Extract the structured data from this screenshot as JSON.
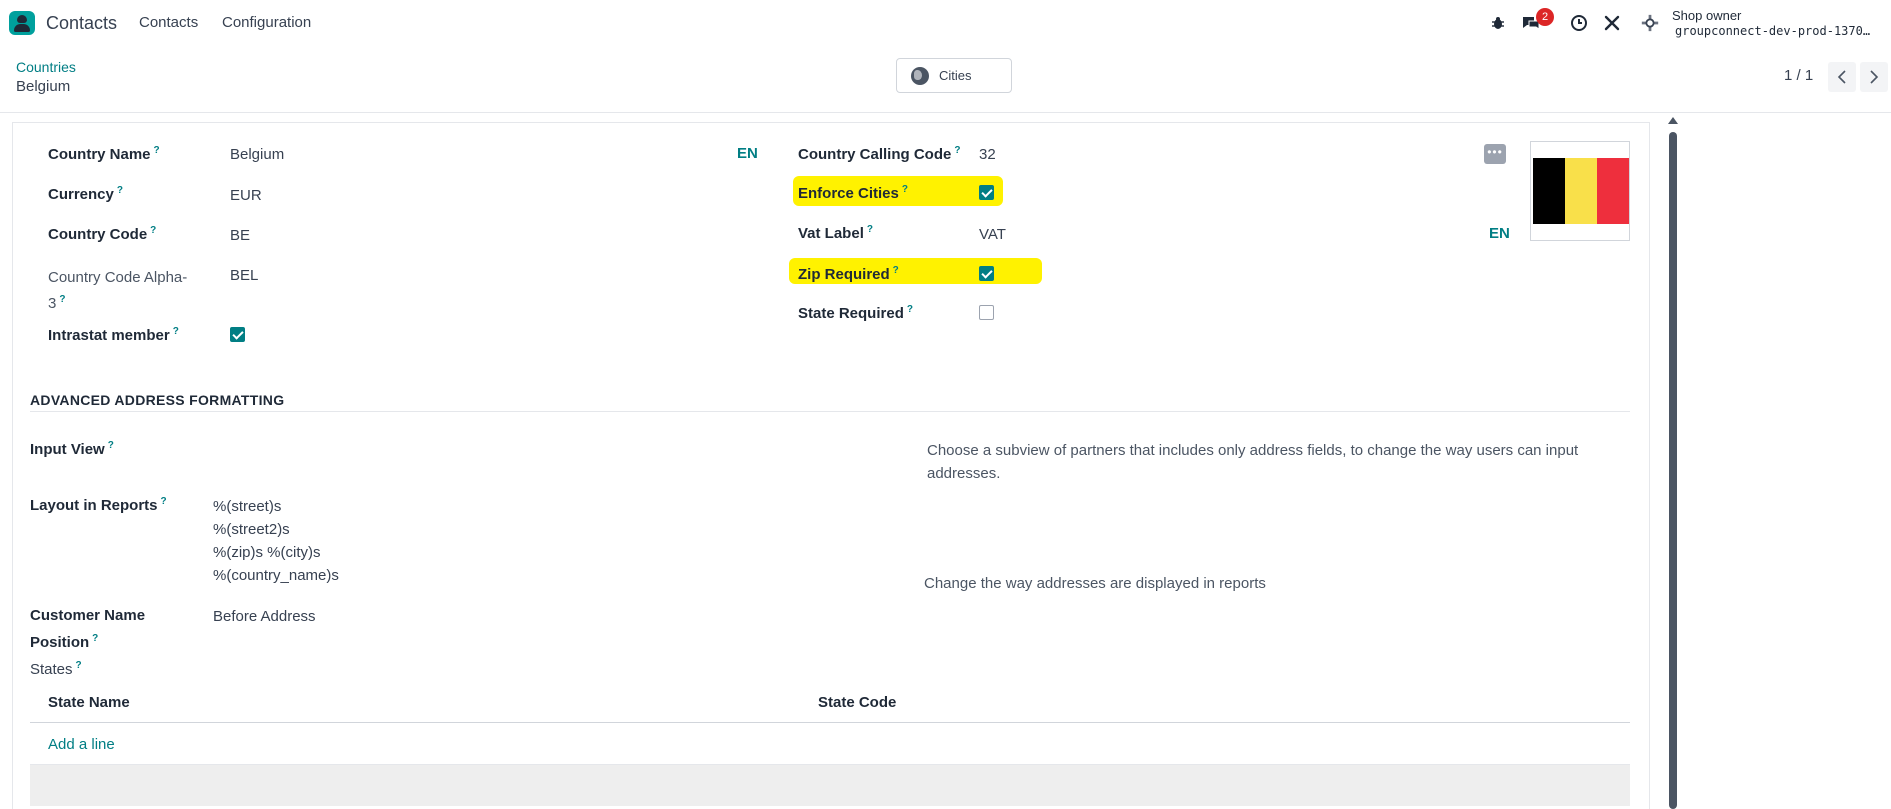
{
  "navbar": {
    "app_name": "Contacts",
    "menu": [
      "Contacts",
      "Configuration"
    ],
    "message_count": "2",
    "user_name": "Shop owner",
    "database": "groupconnect-dev-prod-1370…"
  },
  "control_panel": {
    "breadcrumb_parent": "Countries",
    "breadcrumb_current": "Belgium",
    "smart_button": "Cities",
    "pager": "1 / 1"
  },
  "form": {
    "left": {
      "country_name_label": "Country Name",
      "country_name": "Belgium",
      "lang": "EN",
      "currency_label": "Currency",
      "currency": "EUR",
      "country_code_label": "Country Code",
      "country_code": "BE",
      "alpha3_label_line1": "Country Code Alpha-",
      "alpha3_label_line2": "3",
      "alpha3": "BEL",
      "intrastat_label": "Intrastat member",
      "intrastat": true
    },
    "right": {
      "calling_code_label": "Country Calling Code",
      "calling_code": "32",
      "enforce_cities_label": "Enforce Cities",
      "enforce_cities": true,
      "vat_label_label": "Vat Label",
      "vat_label": "VAT",
      "lang": "EN",
      "zip_required_label": "Zip Required",
      "zip_required": true,
      "state_required_label": "State Required",
      "state_required": false
    },
    "flag_colors": [
      "#000000",
      "#f9e04a",
      "#ee2f3d"
    ],
    "help_mark": "?"
  },
  "advanced": {
    "title": "ADVANCED ADDRESS FORMATTING",
    "input_view_label": "Input View",
    "input_view_help_1": "Choose a subview of partners that includes only address fields, to change the way users can input",
    "input_view_help_2": "addresses.",
    "layout_label": "Layout in Reports",
    "layout_lines": [
      "%(street)s",
      "%(street2)s",
      "%(zip)s %(city)s",
      "%(country_name)s"
    ],
    "layout_help": "Change the way addresses are displayed in reports",
    "customer_name_label_1": "Customer Name",
    "customer_name_label_2": "Position",
    "customer_name_position": "Before Address",
    "states_label": "States",
    "states_columns": [
      "State Name",
      "State Code"
    ],
    "add_line": "Add a line"
  },
  "colors": {
    "accent": "#017e84",
    "highlight": "#fff200",
    "badge": "#dc2626"
  }
}
